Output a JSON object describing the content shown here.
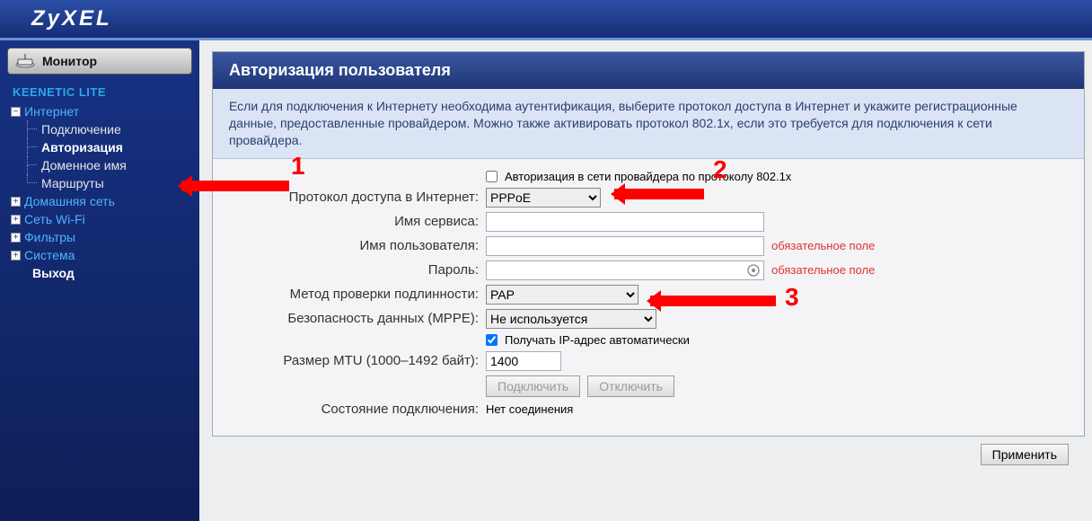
{
  "brand": "ZyXEL",
  "sidebar": {
    "monitor": "Монитор",
    "product": "KEENETIC LITE",
    "internet": {
      "root": "Интернет",
      "items": [
        "Подключение",
        "Авторизация",
        "Доменное имя",
        "Маршруты"
      ]
    },
    "others": [
      "Домашняя сеть",
      "Сеть Wi-Fi",
      "Фильтры",
      "Система"
    ],
    "exit": "Выход"
  },
  "panel": {
    "title": "Авторизация пользователя",
    "desc": "Если для подключения к Интернету необходима аутентификация, выберите протокол доступа в Интернет и укажите регистрационные данные, предоставленные провайдером. Можно также активировать протокол 802.1x, если это требуется для подключения к сети провайдера."
  },
  "form": {
    "chk_8021x_label": "Авторизация в сети провайдера по протоколу 802.1x",
    "chk_8021x": false,
    "proto_label": "Протокол доступа в Интернет:",
    "proto_value": "PPPoE",
    "service_label": "Имя сервиса:",
    "service_value": "",
    "user_label": "Имя пользователя:",
    "user_value": "",
    "pass_label": "Пароль:",
    "pass_value": "",
    "auth_label": "Метод проверки подлинности:",
    "auth_value": "PAP",
    "mppe_label": "Безопасность данных (MPPE):",
    "mppe_value": "Не используется",
    "chk_autoip_label": "Получать IP-адрес автоматически",
    "chk_autoip": true,
    "mtu_label": "Размер MTU (1000–1492 байт):",
    "mtu_value": "1400",
    "btn_connect": "Подключить",
    "btn_disconnect": "Отключить",
    "state_label": "Состояние подключения:",
    "state_value": "Нет соединения",
    "required_hint": "обязательное поле",
    "apply": "Применить"
  },
  "annot": {
    "n1": "1",
    "n2": "2",
    "n3": "3"
  }
}
